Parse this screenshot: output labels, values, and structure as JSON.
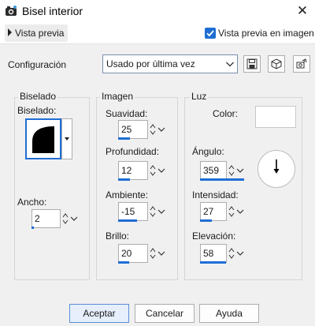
{
  "window": {
    "title": "Bisel interior"
  },
  "toolbar": {
    "preview_toggle": "Vista previa",
    "preview_checkbox": "Vista previa en imagen",
    "preview_checked": true
  },
  "config": {
    "label": "Configuración",
    "selected": "Usado por última vez"
  },
  "bevel": {
    "group_label": "Biselado",
    "shape_label": "Biselado:",
    "width_label": "Ancho:",
    "width_value": "2"
  },
  "image": {
    "group_label": "Imagen",
    "smoothness_label": "Suavidad:",
    "smoothness_value": "25",
    "depth_label": "Profundidad:",
    "depth_value": "12",
    "ambience_label": "Ambiente:",
    "ambience_value": "-15",
    "shininess_label": "Brillo:",
    "shininess_value": "20"
  },
  "light": {
    "group_label": "Luz",
    "color_label": "Color:",
    "color": "#ffffff",
    "angle_label": "Ángulo:",
    "angle_value": "359",
    "intensity_label": "Intensidad:",
    "intensity_value": "27",
    "elevation_label": "Elevación:",
    "elevation_value": "58"
  },
  "buttons": {
    "ok": "Aceptar",
    "cancel": "Cancelar",
    "help": "Ayuda"
  },
  "colors": {
    "accent": "#1f6ed4"
  }
}
